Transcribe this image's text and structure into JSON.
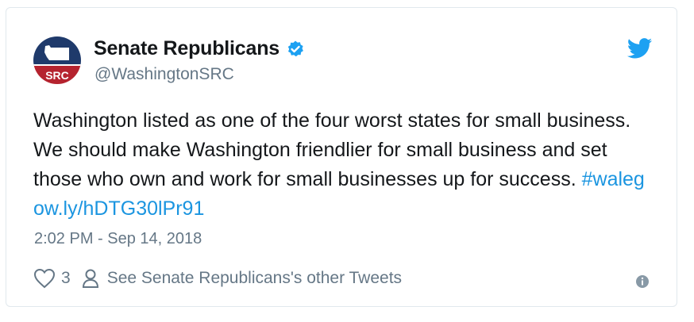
{
  "author": {
    "display_name": "Senate Republicans",
    "handle": "@WashingtonSRC",
    "avatar_text": "SRC"
  },
  "tweet": {
    "text_plain": "Washington listed as one of the four worst states for small business. We should make Washington friendlier for small business and set those who own and work for small businesses up for success.",
    "hashtag": "#waleg",
    "link": "ow.ly/hDTG30lPr91",
    "timestamp": "2:02 PM - Sep 14, 2018"
  },
  "actions": {
    "like_count": "3",
    "other_tweets_label": "See Senate Republicans's other Tweets"
  },
  "icons": {
    "verified": "verified-badge-icon",
    "bird": "twitter-bird-icon",
    "heart": "heart-icon",
    "person": "person-icon",
    "info": "info-icon"
  },
  "colors": {
    "accent": "#1da1f2",
    "link": "#1b95e0",
    "text": "#14171a",
    "muted": "#657786",
    "avatar_top": "#1f3a6b",
    "avatar_bottom": "#b5232f"
  }
}
